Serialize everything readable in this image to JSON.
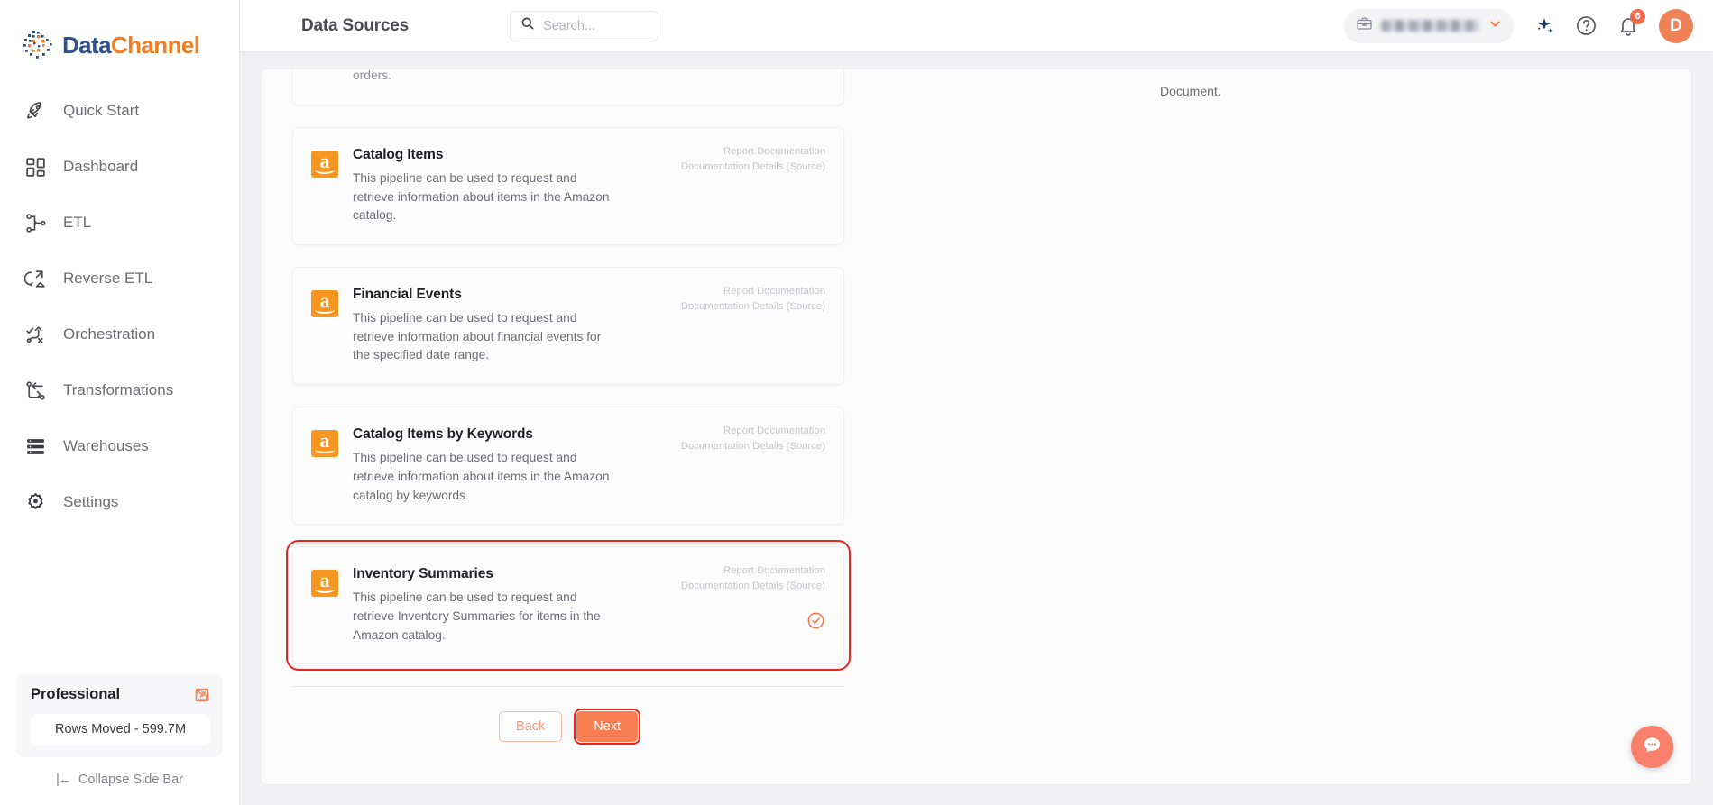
{
  "brand": {
    "name_part1": "Data",
    "name_part2": "Channel"
  },
  "sidebar": {
    "items": [
      {
        "label": "Quick Start",
        "icon": "rocket-icon"
      },
      {
        "label": "Dashboard",
        "icon": "dashboard-grid-icon"
      },
      {
        "label": "ETL",
        "icon": "etl-nodes-icon"
      },
      {
        "label": "Reverse ETL",
        "icon": "reverse-etl-icon"
      },
      {
        "label": "Orchestration",
        "icon": "orchestration-icon"
      },
      {
        "label": "Transformations",
        "icon": "transformations-icon"
      },
      {
        "label": "Warehouses",
        "icon": "warehouse-stack-icon"
      },
      {
        "label": "Settings",
        "icon": "gear-icon"
      }
    ],
    "plan": {
      "name": "Professional",
      "rows_moved": "Rows Moved - 599.7M",
      "external_link_icon": "external-link-icon"
    },
    "collapse": {
      "glyph": "|←",
      "label": "Collapse Side Bar"
    }
  },
  "header": {
    "title": "Data Sources",
    "search": {
      "placeholder": "Search...",
      "value": "",
      "icon": "search-icon"
    },
    "workspace": {
      "icon": "briefcase-icon",
      "name_masked": "",
      "chevron": "chevron-down-icon"
    },
    "ai_icon": "sparkle-icon",
    "help_icon": "help-circle-icon",
    "notifications": {
      "icon": "bell-icon",
      "count": "6"
    },
    "avatar": {
      "initial": "D"
    }
  },
  "main": {
    "clipped_card": {
      "text": "orders."
    },
    "doc_labels": {
      "line1": "Report Documentation",
      "line2": "Documentation Details (Source)"
    },
    "cards": [
      {
        "title": "Catalog Items",
        "description": "This pipeline can be used to request and retrieve information about items in the Amazon catalog.",
        "logo": "amazon-logo-icon",
        "selected": false
      },
      {
        "title": "Financial Events",
        "description": "This pipeline can be used to request and retrieve information about financial events for the specified date range.",
        "logo": "amazon-logo-icon",
        "selected": false
      },
      {
        "title": "Catalog Items by Keywords",
        "description": "This pipeline can be used to request and retrieve information about items in the Amazon catalog by keywords.",
        "logo": "amazon-logo-icon",
        "selected": false
      },
      {
        "title": "Inventory Summaries",
        "description": "This pipeline can be used to request and retrieve Inventory Summaries for items in the Amazon catalog.",
        "logo": "amazon-logo-icon",
        "selected": true,
        "check_icon": "check-circle-icon"
      }
    ],
    "buttons": {
      "back": "Back",
      "next": "Next"
    },
    "detail_panel": {
      "text": "Document."
    }
  },
  "chat_widget": {
    "icon": "chat-bubble-icon"
  },
  "colors": {
    "brand_blue": "#2d5289",
    "brand_orange": "#f07f24",
    "accent_orange": "#f97f52",
    "highlight_red": "#e8261f",
    "amazon_orange": "#f79620",
    "chat_coral": "#f9806a"
  }
}
